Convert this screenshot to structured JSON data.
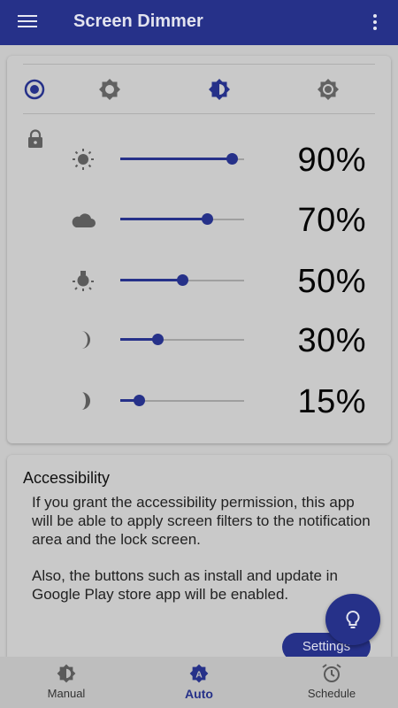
{
  "app": {
    "title": "Screen Dimmer"
  },
  "colors": {
    "primary": "#263189",
    "background": "#c7c7c7",
    "card": "#c9c9c9",
    "track": "#9f9f9f"
  },
  "mode_tabs": [
    {
      "name": "radio-selected-icon",
      "selected": true
    },
    {
      "name": "brightness-icon"
    },
    {
      "name": "contrast-icon"
    },
    {
      "name": "settings-brightness-icon"
    }
  ],
  "lock_icon": "lock-icon",
  "levels": [
    {
      "icon": "sun-icon",
      "value": 90,
      "label": "90%"
    },
    {
      "icon": "cloud-icon",
      "value": 70,
      "label": "70%"
    },
    {
      "icon": "lamp-icon",
      "value": 50,
      "label": "50%"
    },
    {
      "icon": "moon-icon",
      "value": 30,
      "label": "30%"
    },
    {
      "icon": "crescent-moon-icon",
      "value": 15,
      "label": "15%"
    }
  ],
  "accessibility": {
    "title": "Accessibility",
    "paragraph1": "If you grant the accessibility permission, this app will be able to apply screen filters to the notification area and the lock screen.",
    "paragraph2": "Also, the buttons such as install and update in Google Play store app will be enabled.",
    "settings_label": "Settings"
  },
  "fab": {
    "icon": "lightbulb-icon"
  },
  "bottom_nav": [
    {
      "label": "Manual",
      "icon": "contrast-icon"
    },
    {
      "label": "Auto",
      "icon": "auto-brightness-icon",
      "active": true
    },
    {
      "label": "Schedule",
      "icon": "alarm-icon"
    }
  ]
}
